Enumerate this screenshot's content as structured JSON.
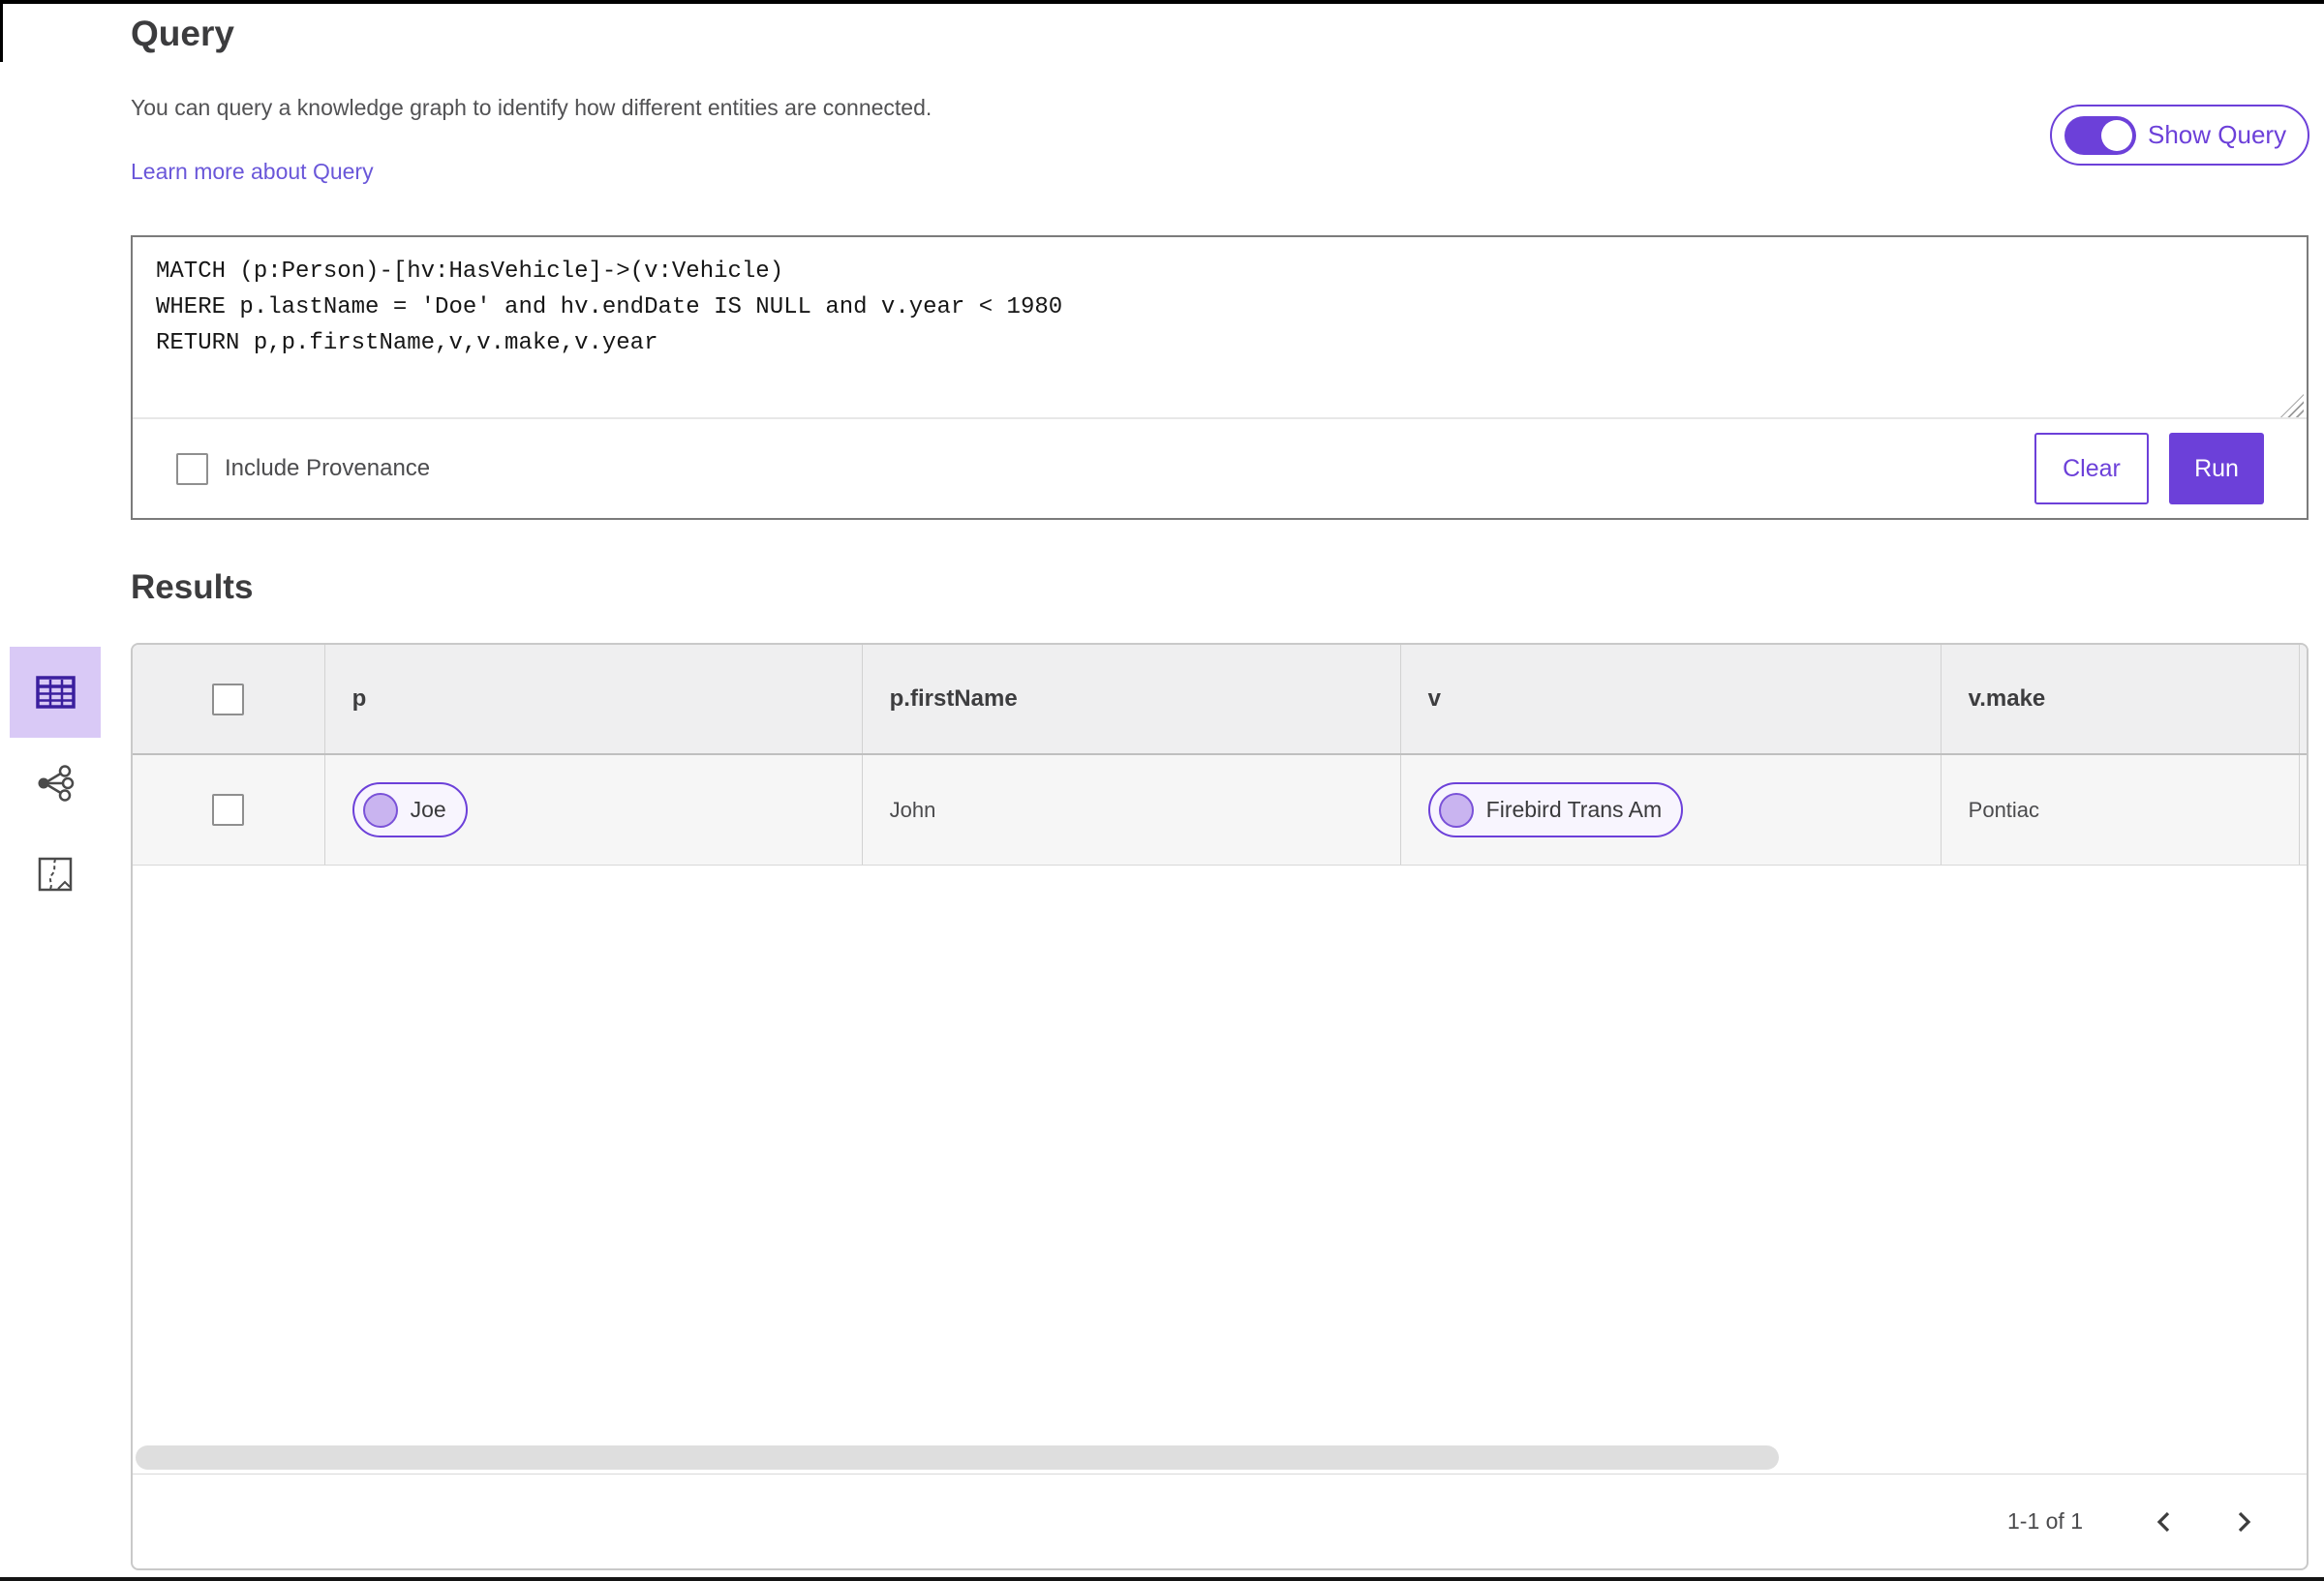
{
  "page": {
    "title": "Query",
    "description": "You can query a knowledge graph to identify how different entities are connected.",
    "learn_more_link": "Learn more about Query"
  },
  "show_query_toggle": {
    "label": "Show Query",
    "state": "on"
  },
  "query_panel": {
    "code": "MATCH (p:Person)-[hv:HasVehicle]->(v:Vehicle)\nWHERE p.lastName = 'Doe' and hv.endDate IS NULL and v.year < 1980\nRETURN p,p.firstName,v,v.make,v.year",
    "include_provenance": {
      "label": "Include Provenance",
      "checked": false
    },
    "clear_button": "Clear",
    "run_button": "Run"
  },
  "results": {
    "heading": "Results",
    "view_tabs": [
      {
        "id": "table-view",
        "icon": "table-icon",
        "selected": true
      },
      {
        "id": "network-view",
        "icon": "network-graph-icon",
        "selected": false
      },
      {
        "id": "map-view",
        "icon": "map-route-icon",
        "selected": false
      }
    ],
    "table": {
      "columns": [
        "p",
        "p.firstName",
        "v",
        "v.make"
      ],
      "rows": [
        {
          "p": "Joe",
          "p_firstName": "John",
          "v": "Firebird Trans Am",
          "v_make": "Pontiac"
        }
      ],
      "select_all_checked": false,
      "row_checked": false
    },
    "pagination": {
      "range": "1-1 of 1"
    }
  },
  "colors": {
    "accent_purple": "#6C40D9",
    "accent_soft": "#D9C9F6",
    "chip_dot_fill": "#C9B4F0",
    "link_purple": "#6A57D9",
    "table_icon_purple": "#3B1F9E"
  }
}
